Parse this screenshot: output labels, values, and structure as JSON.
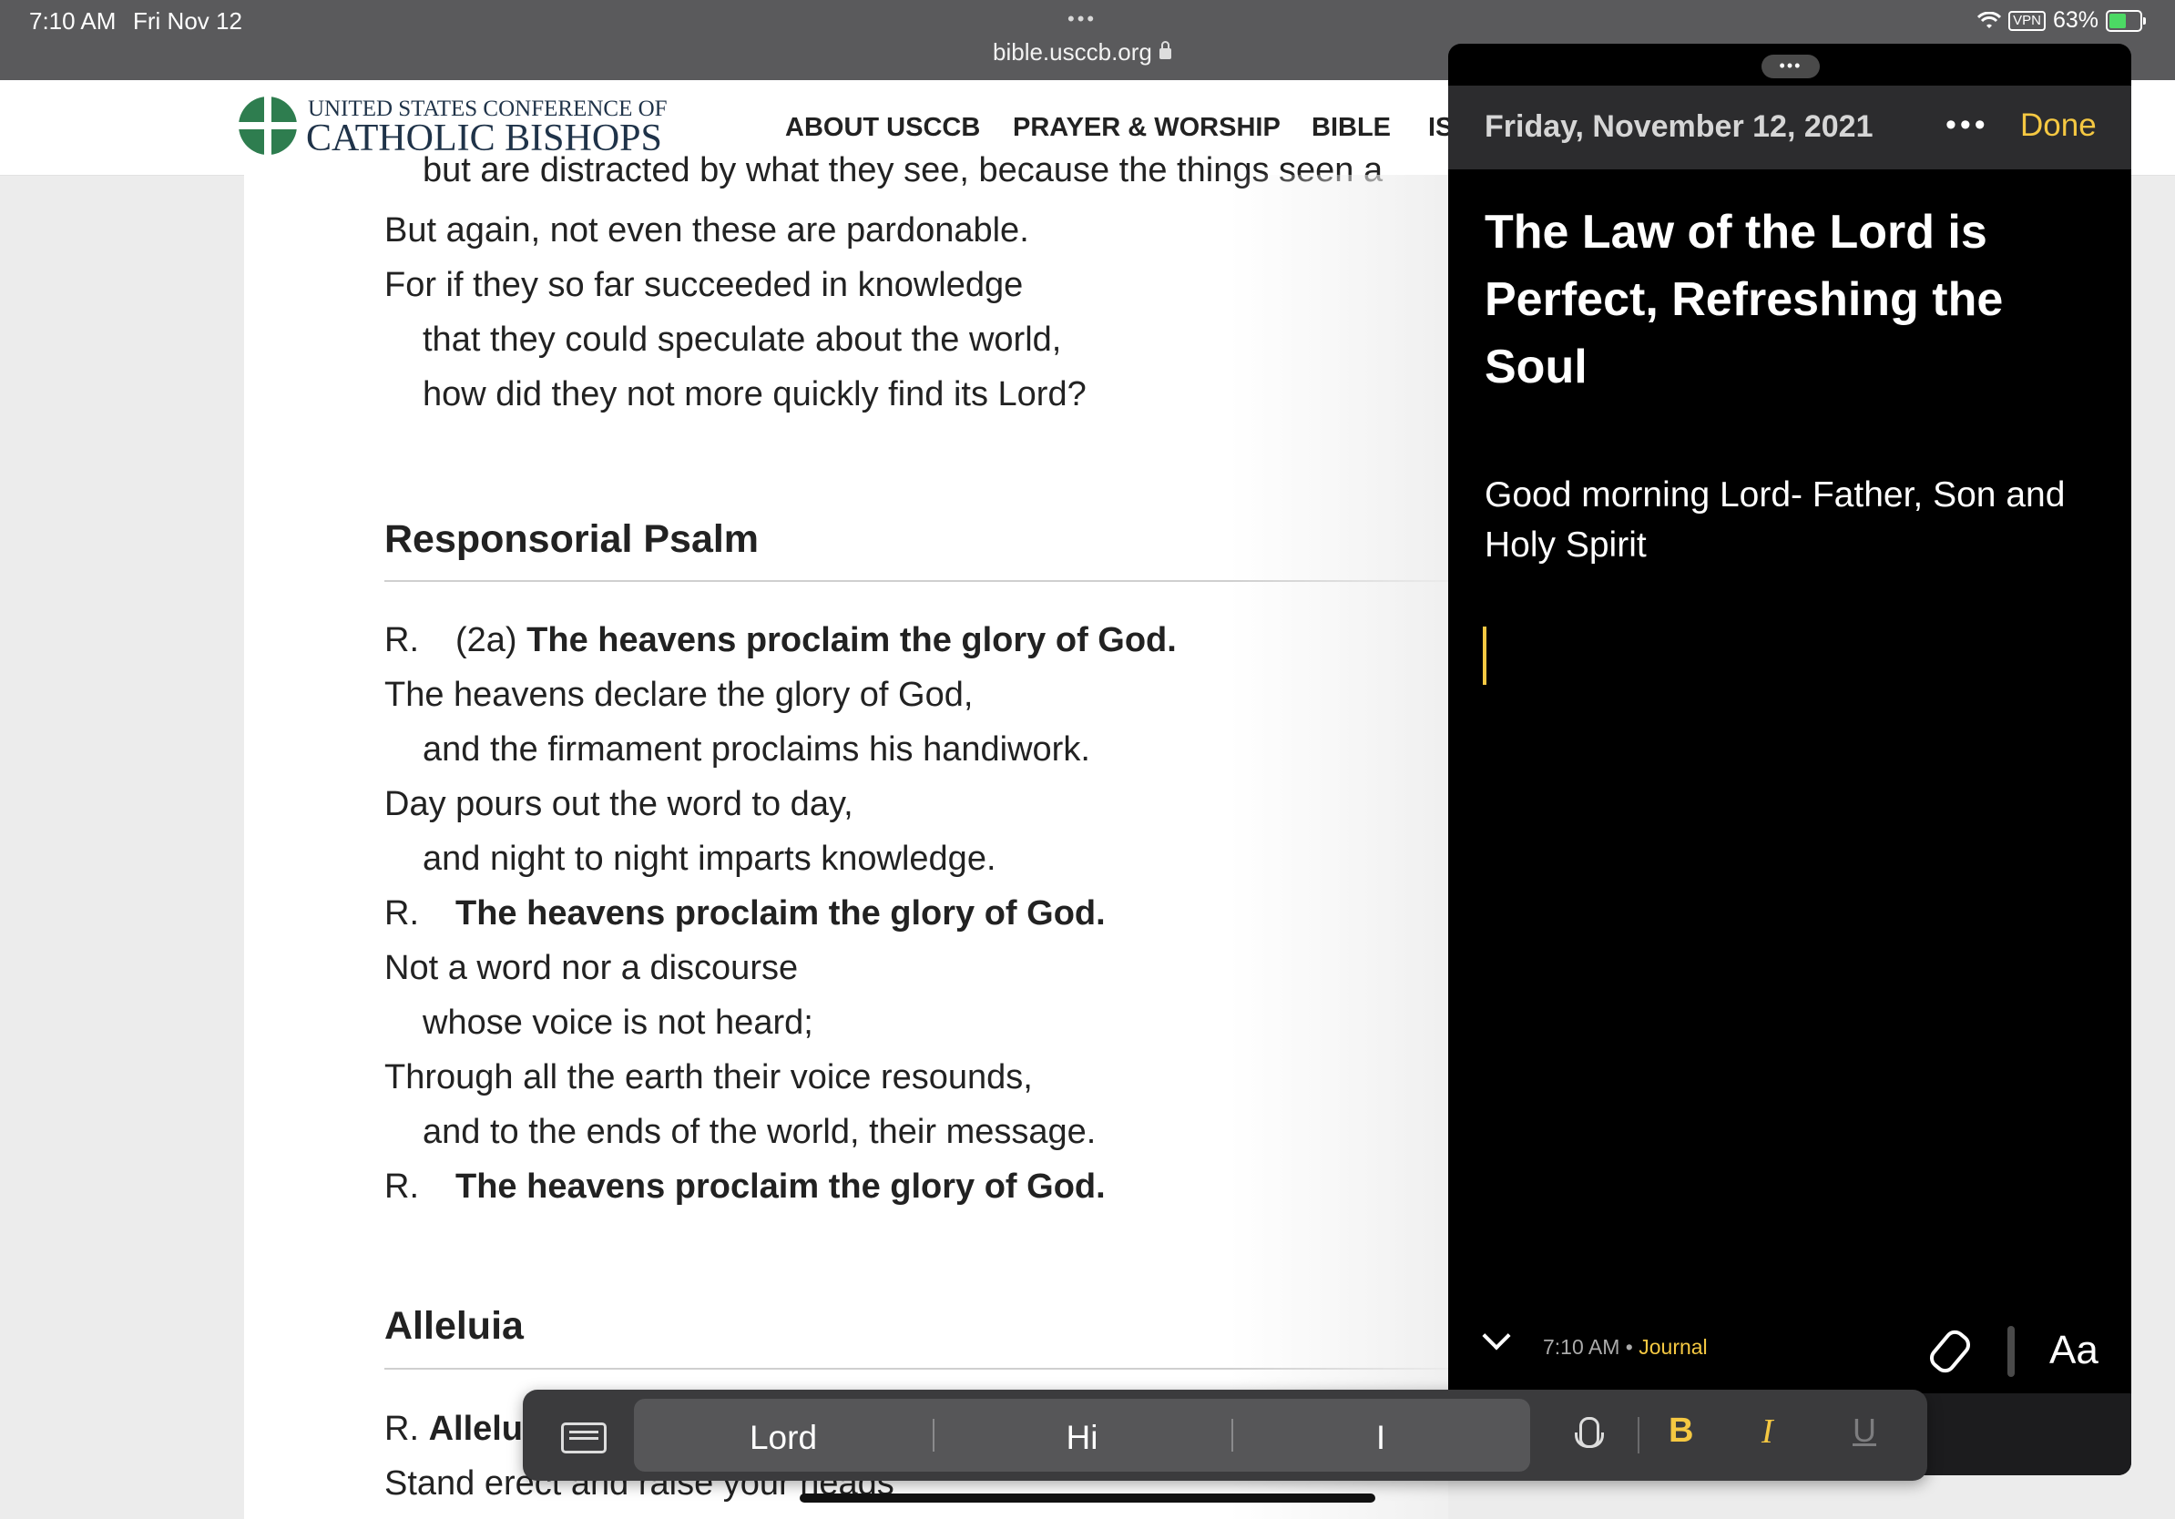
{
  "status_bar": {
    "time": "7:10 AM",
    "date": "Fri Nov 12",
    "url": "bible.usccb.org",
    "vpn": "VPN",
    "battery": "63%",
    "battery_level": 0.63
  },
  "site": {
    "logo_line1": "UNITED STATES CONFERENCE OF",
    "logo_line2": "CATHOLIC BISHOPS",
    "nav": [
      "ABOUT USCCB",
      "PRAYER & WORSHIP",
      "BIBLE",
      "IS"
    ]
  },
  "article": {
    "top_lines": [
      {
        "text": "but are distracted by what they see, because the things seen a",
        "indent": true
      },
      {
        "text": "But again, not even these are pardonable.",
        "indent": false
      },
      {
        "text": "For if they so far succeeded in knowledge",
        "indent": false
      },
      {
        "text": "that they could speculate about the world,",
        "indent": true
      },
      {
        "text": "how did they not more quickly find its Lord?",
        "indent": true
      }
    ],
    "psalm_heading": "Responsorial Psalm",
    "psalm_lines": [
      {
        "type": "r",
        "label": "R.",
        "prefix": "(2a) ",
        "bold": "The heavens proclaim the glory of God."
      },
      {
        "type": "text",
        "text": "The heavens declare the glory of God,",
        "indent": false
      },
      {
        "type": "text",
        "text": "and the firmament proclaims his handiwork.",
        "indent": true
      },
      {
        "type": "text",
        "text": "Day pours out the word to day,",
        "indent": false
      },
      {
        "type": "text",
        "text": "and night to night imparts knowledge.",
        "indent": true
      },
      {
        "type": "r",
        "label": "R.",
        "prefix": "",
        "bold": "The heavens proclaim the glory of God."
      },
      {
        "type": "text",
        "text": "Not a word nor a discourse",
        "indent": false
      },
      {
        "type": "text",
        "text": "whose voice is not heard;",
        "indent": true
      },
      {
        "type": "text",
        "text": "Through all the earth their voice resounds,",
        "indent": false
      },
      {
        "type": "text",
        "text": "and to the ends of the world, their message.",
        "indent": true
      },
      {
        "type": "r",
        "label": "R.",
        "prefix": "",
        "bold": "The heavens proclaim the glory of God."
      }
    ],
    "alleluia_heading": "Alleluia",
    "alleluia_r_label": "R.",
    "alleluia_r_bold": "Allelu",
    "alleluia_line": "Stand erect and raise your heads"
  },
  "journal": {
    "date": "Friday, November 12, 2021",
    "done_label": "Done",
    "title": "The Law of the Lord is Perfect, Refreshing the Soul",
    "body": "Good morning Lord- Father, Son and Holy Spirit",
    "meta_time": "7:10 AM",
    "meta_sep": "•",
    "journal_name": "Journal",
    "font_label": "Aa"
  },
  "quicktype": {
    "suggestions": [
      "Lord",
      "Hi",
      "I"
    ],
    "bold": "B",
    "italic": "I",
    "underline": "U"
  },
  "colors": {
    "accent": "#f5c842",
    "logo_green": "#2e7d4f",
    "panel_bg": "#000000"
  }
}
